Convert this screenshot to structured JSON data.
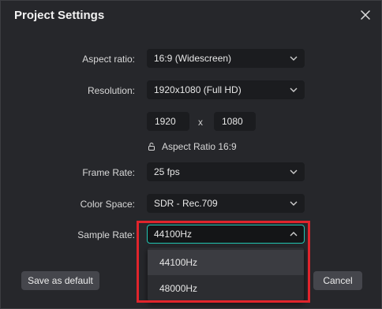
{
  "dialog": {
    "title": "Project Settings"
  },
  "fields": {
    "aspect_ratio": {
      "label": "Aspect ratio:",
      "value": "16:9 (Widescreen)"
    },
    "resolution": {
      "label": "Resolution:",
      "value": "1920x1080 (Full HD)"
    },
    "width": "1920",
    "separator": "x",
    "height": "1080",
    "aspect_lock": "Aspect Ratio 16:9",
    "frame_rate": {
      "label": "Frame Rate:",
      "value": "25 fps"
    },
    "color_space": {
      "label": "Color Space:",
      "value": "SDR - Rec.709"
    },
    "sample_rate": {
      "label": "Sample Rate:",
      "value": "44100Hz"
    }
  },
  "sample_rate_options": [
    "44100Hz",
    "48000Hz"
  ],
  "buttons": {
    "save_default": "Save as default",
    "cancel": "Cancel"
  },
  "colors": {
    "accent": "#21c7b4",
    "highlight": "#e0242c"
  }
}
